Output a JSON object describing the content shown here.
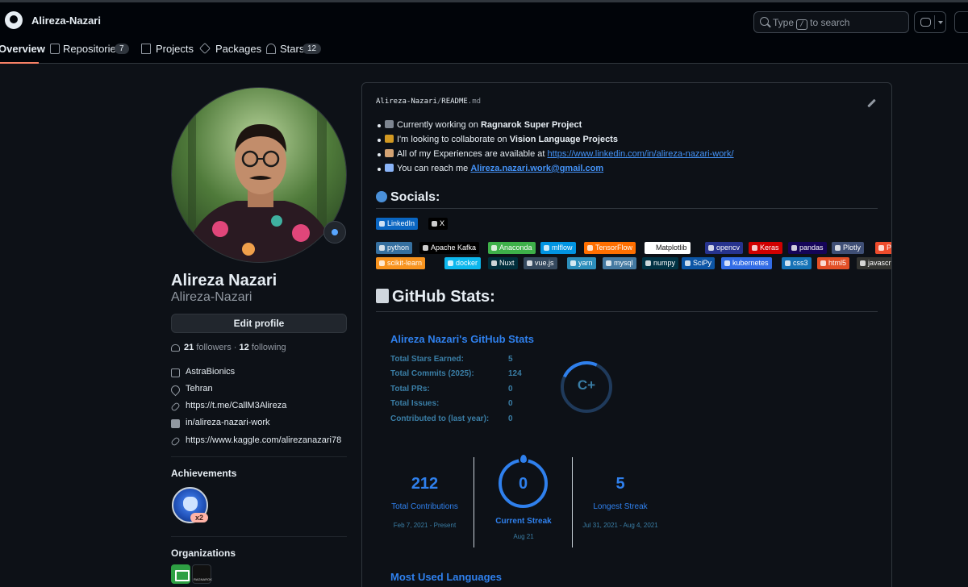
{
  "header": {
    "username": "Alireza-Nazari",
    "search_prefix": "Type",
    "search_key": "/",
    "search_suffix": "to search"
  },
  "tabs": [
    {
      "label": "Overview",
      "count": null,
      "active": true
    },
    {
      "label": "Repositories",
      "count": "7"
    },
    {
      "label": "Projects",
      "count": null
    },
    {
      "label": "Packages",
      "count": null
    },
    {
      "label": "Stars",
      "count": "12"
    }
  ],
  "profile": {
    "full_name": "Alireza Nazari",
    "login": "Alireza-Nazari",
    "edit_label": "Edit profile",
    "followers": "21",
    "followers_label": "followers",
    "following": "12",
    "following_label": "following",
    "dot_sep": "·",
    "company": "AstraBionics",
    "location": "Tehran",
    "link1": "https://t.me/CallM3Alireza",
    "linkedin": "in/alireza-nazari-work",
    "link2": "https://www.kaggle.com/alirezanazari78"
  },
  "achievements": {
    "title": "Achievements",
    "badge_count": "x2"
  },
  "organizations": {
    "title": "Organizations",
    "org2_text": "RAGNAROK"
  },
  "readme": {
    "path_user": "Alireza-Nazari",
    "path_sep": "/",
    "path_file": "README",
    "path_ext": ".md",
    "bullets": [
      {
        "pre": "Currently working on ",
        "bold": "Ragnarok Super Project",
        "post": ""
      },
      {
        "pre": "I'm looking to collaborate on ",
        "bold": "Vision Language Projects",
        "post": ""
      },
      {
        "pre": "All of my Experiences are available at ",
        "link": "https://www.linkedin.com/in/alireza-nazari-work/"
      },
      {
        "pre": "You can reach me ",
        "link_bold": "Alireza.nazari.work@gmail.com"
      }
    ],
    "socials_title": "Socials:",
    "socials": [
      {
        "label": "LinkedIn",
        "color": "#0a66c2"
      },
      {
        "label": "X",
        "color": "#000000"
      }
    ],
    "skills": [
      {
        "label": "python",
        "color": "#3670a0"
      },
      {
        "label": "Apache Kafka",
        "color": "#000000"
      },
      {
        "label": "Anaconda",
        "color": "#3eb049"
      },
      {
        "label": "mlflow",
        "color": "#0194e2"
      },
      {
        "label": "TensorFlow",
        "color": "#ff6f00"
      },
      {
        "label": "Matplotlib",
        "color": "#ffffff"
      },
      {
        "label": "opencv",
        "color": "#27338e"
      },
      {
        "label": "Keras",
        "color": "#d00000"
      },
      {
        "label": "pandas",
        "color": "#150458"
      },
      {
        "label": "Plotly",
        "color": "#3f4f75"
      },
      {
        "label": "PyTorch",
        "color": "#ee4c2c"
      },
      {
        "label": "scikit-learn",
        "color": "#f7931e"
      },
      {
        "label": "docker",
        "color": "#0db7ed"
      },
      {
        "label": "Nuxt",
        "color": "#002e3b"
      },
      {
        "label": "vue.js",
        "color": "#35495e"
      },
      {
        "label": "yarn",
        "color": "#2c8ebb"
      },
      {
        "label": "mysql",
        "color": "#4479a1"
      },
      {
        "label": "numpy",
        "color": "#013243"
      },
      {
        "label": "SciPy",
        "color": "#0c55a5"
      },
      {
        "label": "kubernetes",
        "color": "#326ce5"
      },
      {
        "label": "css3",
        "color": "#1572b6"
      },
      {
        "label": "html5",
        "color": "#e34f26"
      },
      {
        "label": "javascript",
        "color": "#323330"
      }
    ],
    "stats_heading": "GitHub Stats:"
  },
  "stats_card": {
    "title": "Alireza Nazari's GitHub Stats",
    "rows": [
      {
        "label": "Total Stars Earned:",
        "value": "5"
      },
      {
        "label": "Total Commits (2025):",
        "value": "124"
      },
      {
        "label": "Total PRs:",
        "value": "0"
      },
      {
        "label": "Total Issues:",
        "value": "0"
      },
      {
        "label": "Contributed to (last year):",
        "value": "0"
      }
    ],
    "rank": "C+"
  },
  "streak": {
    "total": "212",
    "total_label": "Total Contributions",
    "total_range": "Feb 7, 2021 - Present",
    "current": "0",
    "current_label": "Current Streak",
    "current_date": "Aug 21",
    "longest": "5",
    "longest_label": "Longest Streak",
    "longest_range": "Jul 31, 2021 - Aug 4, 2021"
  },
  "languages_title": "Most Used Languages",
  "colors": {
    "accent": "#2f80ed",
    "link": "#4493f8",
    "tab_underline": "#f78166"
  }
}
